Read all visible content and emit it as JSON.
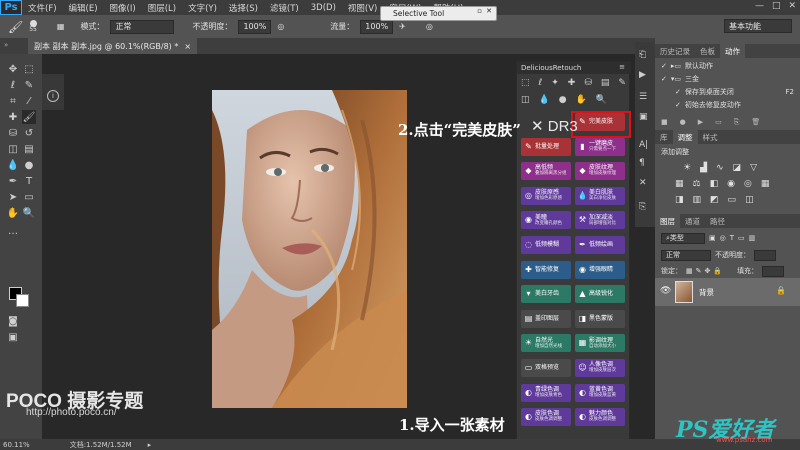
{
  "menubar": {
    "logo": "Ps",
    "items": [
      "文件(F)",
      "编辑(E)",
      "图像(I)",
      "图层(L)",
      "文字(Y)",
      "选择(S)",
      "滤镜(T)",
      "3D(D)",
      "视图(V)",
      "窗口(W)",
      "帮助(H)"
    ],
    "window_controls": [
      "—",
      "□",
      "✕"
    ]
  },
  "options_bar": {
    "brush_size": "55",
    "mode_label": "模式：",
    "mode_value": "正常",
    "opacity_label": "不透明度：",
    "opacity_value": "100%",
    "flow_label": "流量：",
    "flow_value": "100%",
    "workspace": "基本功能"
  },
  "selective_tool": {
    "title": "Selective Tool"
  },
  "document": {
    "tab_title": "副本 副本 副本.jpg @ 60.1%(RGB/8) *",
    "tab_close": "×"
  },
  "dr3": {
    "title": "DeliciousRetouch",
    "logo_text": "DR3",
    "buttons": [
      {
        "label": "完美皮肤",
        "sub": "",
        "color": "#a83236",
        "icon": "brush-icon"
      },
      {
        "label": "批量处理",
        "sub": "",
        "color": "#a83236",
        "icon": "brush-icon"
      },
      {
        "label": "一键磨皮",
        "sub": "只需要点一下",
        "color": "#8e2f8b",
        "icon": "bottle-icon"
      },
      {
        "label": "高低频",
        "sub": "叠加隔离黑分组",
        "color": "#8e2f8b",
        "icon": "gem-icon"
      },
      {
        "label": "皮肤纹理",
        "sub": "增加皮肤纹理",
        "color": "#8e2f8b",
        "icon": "gem-icon"
      },
      {
        "label": "皮肤原感",
        "sub": "增加色彩原感",
        "color": "#5f3a9a",
        "icon": "dial-icon"
      },
      {
        "label": "美白肌肤",
        "sub": "美白净化皮肤",
        "color": "#5f3a9a",
        "icon": "drop-icon"
      },
      {
        "label": "美瞳",
        "sub": "改变瞳孔颜色",
        "color": "#5f3a9a",
        "icon": "eye-icon"
      },
      {
        "label": "加深减淡",
        "sub": "局部增强对比",
        "color": "#5f3a9a",
        "icon": "tool-icon"
      },
      {
        "label": "低频模糊",
        "sub": "",
        "color": "#5f3a9a",
        "icon": "blur-icon"
      },
      {
        "label": "低频绘画",
        "sub": "",
        "color": "#5f3a9a",
        "icon": "pen-icon"
      },
      {
        "label": "智能修复",
        "sub": "",
        "color": "#2b5c8a",
        "icon": "patch-icon"
      },
      {
        "label": "增强眼睛",
        "sub": "",
        "color": "#2b5c8a",
        "icon": "eye-icon"
      },
      {
        "label": "美白牙齿",
        "sub": "",
        "color": "#2c7a66",
        "icon": "tooth-icon"
      },
      {
        "label": "高级锐化",
        "sub": "",
        "color": "#2c7a66",
        "icon": "triangle-icon"
      },
      {
        "label": "盖印图层",
        "sub": "",
        "color": "#4a4a4a",
        "icon": "layer-icon"
      },
      {
        "label": "黑色蒙版",
        "sub": "",
        "color": "#4a4a4a",
        "icon": "mask-icon"
      },
      {
        "label": "自然光",
        "sub": "增加自然光线",
        "color": "#2c7a66",
        "icon": "sun-icon"
      },
      {
        "label": "影调纹理",
        "sub": "自动添加大小",
        "color": "#2c7a66",
        "icon": "texture-icon"
      },
      {
        "label": "双格预览",
        "sub": "",
        "color": "#4a4a4a",
        "icon": "preview-icon"
      },
      {
        "label": "人像色调",
        "sub": "增加皮肤层次",
        "color": "#5f3a9a",
        "icon": "person-icon"
      },
      {
        "label": "青绿色调",
        "sub": "增加皮肤青色",
        "color": "#5f3a9a",
        "icon": "palette-icon"
      },
      {
        "label": "蓝黄色调",
        "sub": "增加皮肤蓝黄",
        "color": "#5f3a9a",
        "icon": "palette-icon"
      },
      {
        "label": "皮肤色调",
        "sub": "皮肤色调调整",
        "color": "#5f3a9a",
        "icon": "palette-icon"
      },
      {
        "label": "魅力颜色",
        "sub": "皮肤色调调整",
        "color": "#5f3a9a",
        "icon": "palette-icon"
      }
    ]
  },
  "right_panels": {
    "top_tabs": [
      "历史记录",
      "色板",
      "动作"
    ],
    "actions": [
      "默认动作",
      "三金",
      "保存到桌面关闭",
      "初始去修复皮动作"
    ],
    "action_shortcut": "F2",
    "mid_tabs": [
      "库",
      "调整",
      "样式"
    ],
    "adjust_label": "添加调整",
    "layer_tabs": [
      "图层",
      "通道",
      "路径"
    ],
    "layer_kind": "类型",
    "blend_mode": "正常",
    "opacity_label": "不透明度：",
    "lock_label": "锁定：",
    "fill_label": "填充：",
    "layer_name": "背景"
  },
  "status": {
    "zoom": "60.11%",
    "doc_size": "文档:1.52M/1.52M"
  },
  "annotations": {
    "step1": "1.导入一张素材",
    "step2": "2.点击“完美皮肤”"
  },
  "watermarks": {
    "poco": "POCO 摄影专题",
    "poco_url": "http://photo.poco.cn/",
    "ps_brand": "PS爱好者",
    "ps_url": "www.psahz.com"
  }
}
